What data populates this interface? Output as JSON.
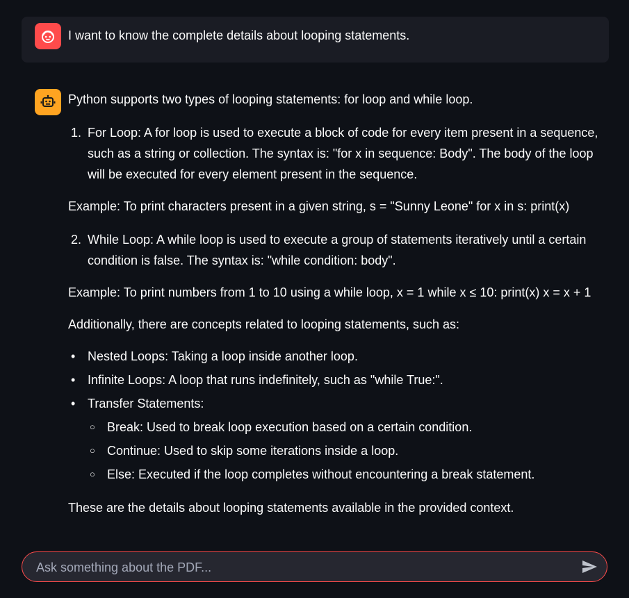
{
  "chat": {
    "user_message": {
      "avatar_icon": "user-face-icon",
      "avatar_color": "#ff4b4b",
      "text": "I want to know the complete details about looping statements."
    },
    "assistant_message": {
      "avatar_icon": "robot-icon",
      "avatar_color": "#ffa421",
      "intro": "Python supports two types of looping statements: for loop and while loop.",
      "ordered_1": {
        "number": "1.",
        "text": "For Loop: A for loop is used to execute a block of code for every item present in a sequence, such as a string or collection. The syntax is: \"for x in sequence: Body\". The body of the loop will be executed for every element present in the sequence."
      },
      "example_1": "Example: To print characters present in a given string, s = \"Sunny Leone\" for x in s: print(x)",
      "ordered_2": {
        "number": "2.",
        "text": "While Loop: A while loop is used to execute a group of statements iteratively until a certain condition is false. The syntax is: \"while condition: body\"."
      },
      "example_2": "Example: To print numbers from 1 to 10 using a while loop, x = 1 while x ≤ 10: print(x) x = x + 1",
      "additional": "Additionally, there are concepts related to looping statements, such as:",
      "bullets": [
        "Nested Loops: Taking a loop inside another loop.",
        "Infinite Loops: A loop that runs indefinitely, such as \"while True:\".",
        "Transfer Statements:"
      ],
      "sub_bullets": [
        "Break: Used to break loop execution based on a certain condition.",
        "Continue: Used to skip some iterations inside a loop.",
        "Else: Executed if the loop completes without encountering a break statement."
      ],
      "closing": "These are the details about looping statements available in the provided context."
    }
  },
  "input": {
    "placeholder": "Ask something about the PDF...",
    "value": "",
    "border_color": "#ff4b4b",
    "send_icon": "send-icon"
  },
  "theme": {
    "background": "#0e1117",
    "user_bubble": "#1a1c24",
    "text": "#fafafa"
  }
}
